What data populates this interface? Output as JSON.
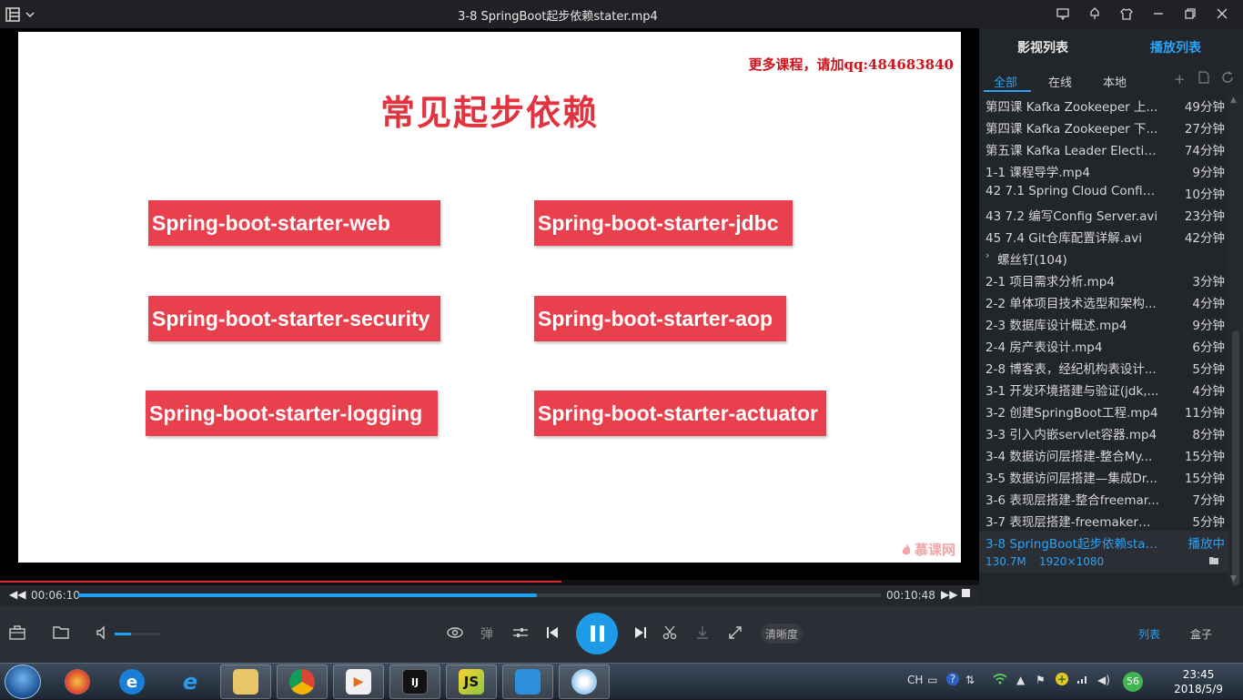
{
  "window": {
    "title": "3-8 SpringBoot起步依赖stater.mp4",
    "icons": [
      "menu-icon",
      "chevron-down-icon",
      "feedback-icon",
      "skin-icon",
      "shirt-icon",
      "minimize-icon",
      "restore-icon",
      "close-icon"
    ]
  },
  "slide": {
    "watermark": "更多课程，请加qq:484683840",
    "title": "常见起步依赖",
    "chips": [
      "Spring-boot-starter-web",
      "Spring-boot-starter-jdbc",
      "Spring-boot-starter-security",
      "Spring-boot-starter-aop",
      "Spring-boot-starter-logging",
      "Spring-boot-starter-actuator"
    ],
    "logo": "慕课网"
  },
  "playback": {
    "current_time": "00:06:10",
    "total_time": "00:10:48",
    "progress": 0.571,
    "volume": 0.35
  },
  "controls": {
    "danmaku_label": "弹",
    "quality_label": "清晰度",
    "list_label": "列表",
    "box_label": "盒子"
  },
  "panel": {
    "tab_media": "影视列表",
    "tab_playlist": "播放列表",
    "sub_all": "全部",
    "sub_online": "在线",
    "sub_local": "本地",
    "items": [
      {
        "name": "第四课 Kafka Zookeeper 上...",
        "dur": "49分钟"
      },
      {
        "name": "第四课 Kafka Zookeeper 下...",
        "dur": "27分钟"
      },
      {
        "name": "第五课 Kafka Leader Electio...",
        "dur": "74分钟"
      },
      {
        "name": "1-1 课程导学.mp4",
        "dur": "9分钟"
      },
      {
        "name": "42 7.1 Spring Cloud Config...",
        "dur": "10分钟"
      },
      {
        "name": "43 7.2 编写Config Server.avi",
        "dur": "23分钟"
      },
      {
        "name": "45 7.4 Git仓库配置详解.avi",
        "dur": "42分钟"
      }
    ],
    "folder": "螺丝钉(104)",
    "items2": [
      {
        "name": "2-1 项目需求分析.mp4",
        "dur": "3分钟"
      },
      {
        "name": "2-2 单体项目技术选型和架构...",
        "dur": "4分钟"
      },
      {
        "name": "2-3 数据库设计概述.mp4",
        "dur": "9分钟"
      },
      {
        "name": "2-4 房产表设计.mp4",
        "dur": "6分钟"
      },
      {
        "name": "2-8 博客表，经纪机构表设计...",
        "dur": "5分钟"
      },
      {
        "name": "3-1 开发环境搭建与验证(jdk,...",
        "dur": "4分钟"
      },
      {
        "name": "3-2 创建SpringBoot工程.mp4",
        "dur": "11分钟"
      },
      {
        "name": "3-3 引入内嵌servlet容器.mp4",
        "dur": "8分钟"
      },
      {
        "name": "3-4 数据访问层搭建-整合My...",
        "dur": "15分钟"
      },
      {
        "name": "3-5 数据访问层搭建—集成Dr...",
        "dur": "15分钟"
      },
      {
        "name": "3-6 表现层搭建-整合freemar...",
        "dur": "7分钟"
      },
      {
        "name": "3-7 表现层搭建-freemaker结...",
        "dur": "5分钟"
      }
    ],
    "current": {
      "name": "3-8 SpringBoot起步依赖stat...",
      "status": "播放中",
      "size": "130.7M",
      "resolution": "1920×1080"
    }
  },
  "taskbar": {
    "apps": [
      "windows-start",
      "ball-app",
      "ie-browser",
      "ie-browser-2",
      "file-explorer",
      "chrome",
      "video-player",
      "intellij-idea",
      "webstorm-js",
      "media-app",
      "paint-app"
    ],
    "tray_lang": "CH",
    "tray_badge": "56",
    "time": "23:45",
    "date": "2018/5/9"
  }
}
